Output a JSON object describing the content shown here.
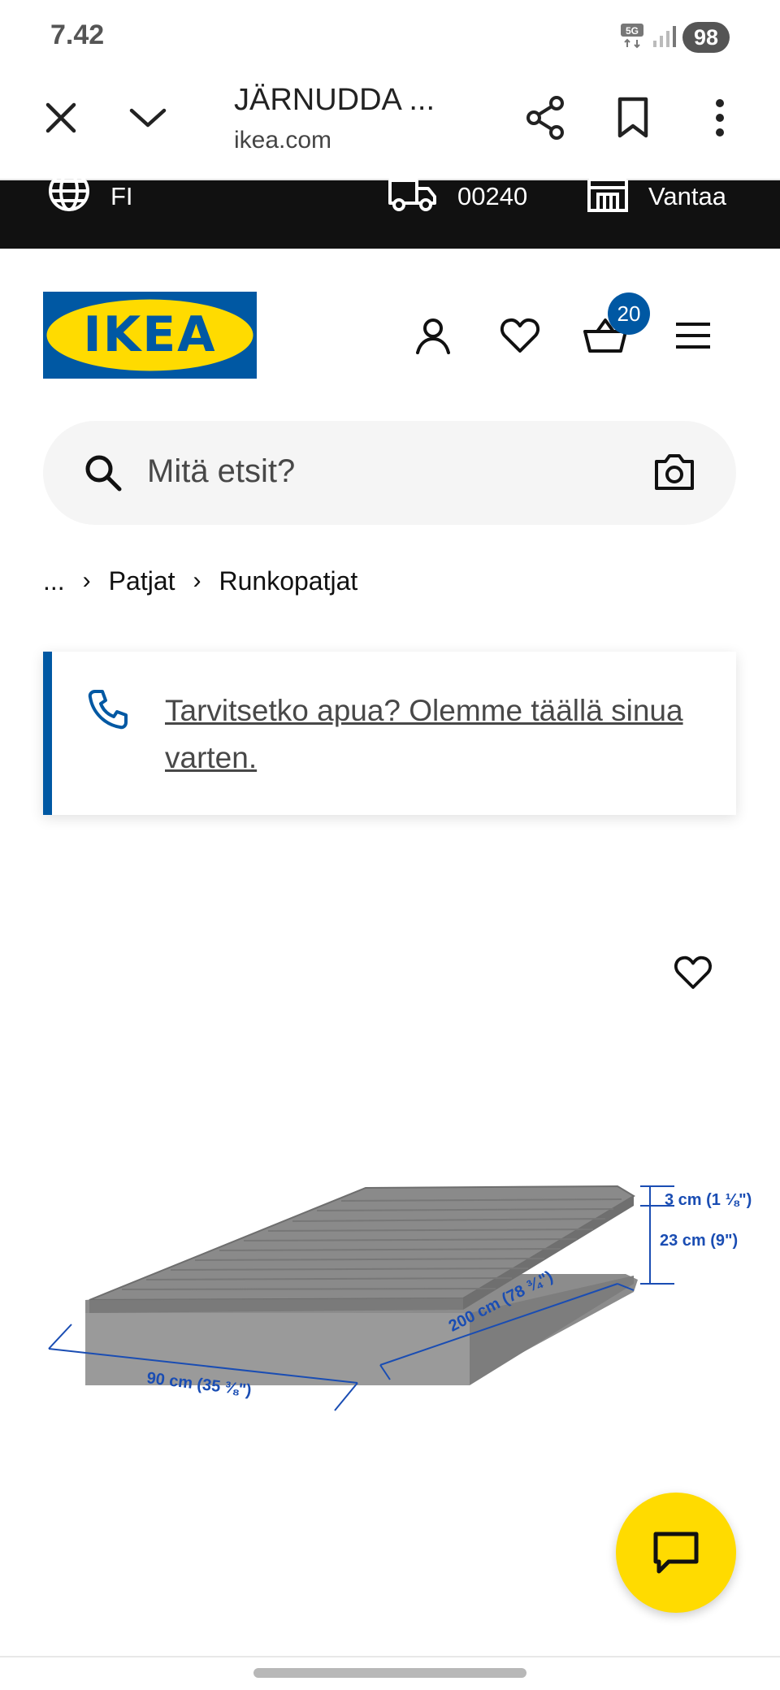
{
  "status_bar": {
    "time": "7.42",
    "network": "5G",
    "battery": "98"
  },
  "browser": {
    "title": "JÄRNUDDA ...",
    "url": "ikea.com"
  },
  "top_strip": {
    "language": "FI",
    "postal_code": "00240",
    "store": "Vantaa"
  },
  "header": {
    "logo_text": "IKEA",
    "cart_count": "20"
  },
  "search": {
    "placeholder": "Mitä etsit?"
  },
  "breadcrumb": {
    "items": [
      "...",
      "Patjat",
      "Runkopatjat"
    ]
  },
  "help": {
    "text": "Tarvitsetko apua? Olemme täällä sinua varten."
  },
  "product_dimensions": {
    "topper_height": "3 cm (1 ⅛\")",
    "mattress_height": "23 cm (9\")",
    "length": "200 cm (78 ¾\")",
    "width": "90 cm (35 ⅜\")"
  },
  "colors": {
    "ikea_blue": "#0058a3",
    "ikea_yellow": "#ffdb00",
    "strip_black": "#111111"
  }
}
